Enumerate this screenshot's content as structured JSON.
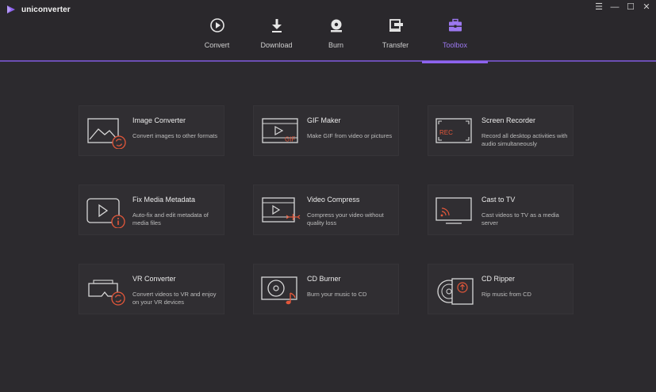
{
  "app": {
    "name": "uniconverter"
  },
  "window_controls": {
    "menu": "☰",
    "minimize": "—",
    "maximize": "☐",
    "close": "✕"
  },
  "tabs": [
    {
      "label": "Convert",
      "icon": "convert-icon",
      "active": false
    },
    {
      "label": "Download",
      "icon": "download-icon",
      "active": false
    },
    {
      "label": "Burn",
      "icon": "burn-icon",
      "active": false
    },
    {
      "label": "Transfer",
      "icon": "transfer-icon",
      "active": false
    },
    {
      "label": "Toolbox",
      "icon": "toolbox-icon",
      "active": true
    }
  ],
  "tools": [
    {
      "title": "Image Converter",
      "desc": "Convert images to other formats",
      "icon": "image-convert-icon"
    },
    {
      "title": "GIF Maker",
      "desc": "Make GIF from video or pictures",
      "icon": "gif-icon",
      "icon_text": "GIF"
    },
    {
      "title": "Screen Recorder",
      "desc": "Record all desktop activities with audio simultaneously",
      "icon": "screen-record-icon",
      "icon_text": "REC"
    },
    {
      "title": "Fix Media Metadata",
      "desc": "Auto-fix and edit metadata of media files",
      "icon": "metadata-icon"
    },
    {
      "title": "Video Compress",
      "desc": "Compress your video without quality loss",
      "icon": "video-compress-icon"
    },
    {
      "title": "Cast to TV",
      "desc": "Cast videos to TV as a media server",
      "icon": "cast-tv-icon"
    },
    {
      "title": "VR Converter",
      "desc": "Convert videos to VR and enjoy on your VR devices",
      "icon": "vr-icon"
    },
    {
      "title": "CD Burner",
      "desc": "Burn your music to CD",
      "icon": "cd-burn-icon"
    },
    {
      "title": "CD Ripper",
      "desc": "Rip music from CD",
      "icon": "cd-rip-icon"
    }
  ],
  "colors": {
    "accent": "#8e63ef",
    "orange": "#e4573a",
    "background": "#2c2a2e",
    "card": "#302e32"
  }
}
